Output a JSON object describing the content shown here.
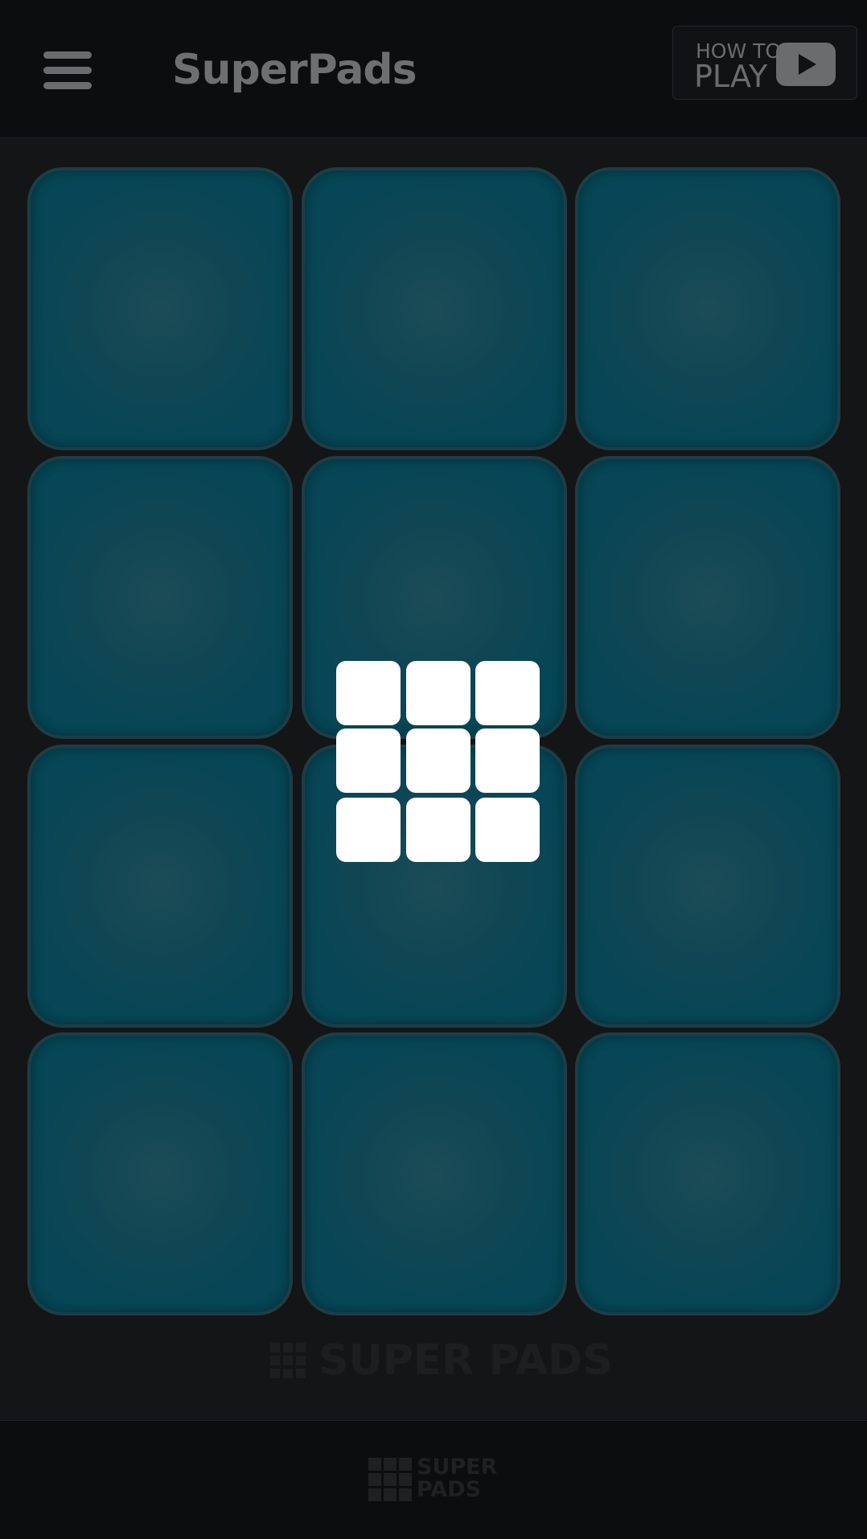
{
  "header": {
    "title": "SuperPads",
    "menu_icon": "hamburger-menu-icon",
    "how_to_play": {
      "line1": "HOW TO",
      "line2": "PLAY",
      "icon": "youtube-play-icon"
    }
  },
  "pads": {
    "count": 12,
    "color": "#064656"
  },
  "loading": {
    "icon": "pad-grid-loading-icon",
    "color": "#ffffff"
  },
  "brand": {
    "text": "SUPER PADS",
    "icon": "pad-grid-logo-icon"
  },
  "footer": {
    "logo_line1": "SUPER",
    "logo_line2": "PADS",
    "icon": "pad-grid-logo-icon"
  }
}
